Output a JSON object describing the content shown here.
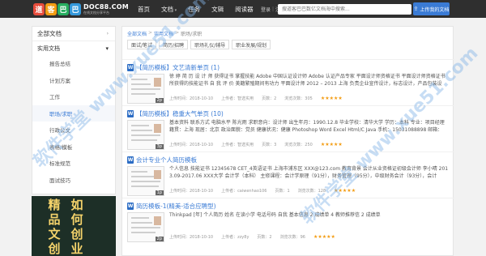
{
  "header": {
    "logo_chars": [
      "道",
      "客",
      "巴",
      "巴"
    ],
    "logo_title": "DOC88.COM",
    "logo_subtitle": "在线文档分享平台",
    "nav": [
      "首页",
      "文档",
      "任务",
      "文辑",
      "阅读器"
    ],
    "login": "登录",
    "register": "注册",
    "search_placeholder": "搜道客巴巴数亿文档海中搜索...",
    "upload_label": "上传我的文档"
  },
  "sidebar": {
    "title": "全部文档",
    "category": "实用文档",
    "items": [
      "报告总结",
      "计划方案",
      "工作",
      "职场/求职",
      "行政公文",
      "表格/模板",
      "标准规范",
      "面试技巧"
    ],
    "active_index": 3
  },
  "promo": {
    "text_col1": "精品文创",
    "text_col2": "如何创业"
  },
  "breadcrumb": [
    "全部文档",
    "实用文档",
    "职场/求职"
  ],
  "tabs": [
    "面试/笔试",
    "简历/招聘",
    "职场礼仪/辅导",
    "职业发展/规划"
  ],
  "documents": [
    {
      "title": "【简历模板】文艺清新单页 (1)",
      "excerpt": "徐 婷 简 历 设 计 师 获得证书 掌握技能 Adobe 中国认证设计师 Adobe 认证产品专家 平面设计师资格证书 平面设计师资格证书 所获得的技能证书 自 我 评 价 美籍繁殖期间有功力 平面设计师 2012 – 2013 上海 负责企业宣传设计，标志设计，产品包装设",
      "date": "上传时间：2018-10-10",
      "uploader": "上传者：智选实用",
      "pages": "页数：2",
      "views": "浏览次数：305",
      "rating": 5
    },
    {
      "title": "【简历模板】稳重大气单页 (10)",
      "excerpt": "基本资料 联系方式 电脑水平 陈光雨 求职意向：设计师 出生年月：1990.12.8 毕业学校：清华大学 学历：本科 专业：项目经理 籍贯：上海 现居：北京 政治面貌：党员 健康状况：健康 Photoshop Word Excel Html/C Java 手机：15031088898 邮箱：",
      "date": "上传时间：2018-10-10",
      "uploader": "上传者：智选实用",
      "pages": "页数：3",
      "views": "浏览次数：250",
      "rating": 5
    },
    {
      "title": "会计专业个人简历模板",
      "excerpt": "个人信息 技能证书 12345678 CET_4英语证书 上海市浦东区 XXX@123.com 教育背景 会计从业资格证初级会计师 李小晴 2013.09-2017.06 XXX大学 会计学（本科） 主修课程：会计学原理（91分），财务管理（95分），中级财务会计（93分），会计",
      "date": "上传时间：2018-10-10",
      "uploader": "上传者：caiwenhao106",
      "pages": "页数：1",
      "views": "浏览次数：128",
      "rating": 5
    },
    {
      "title": "简历模板-1(精美-适合应聘型)",
      "excerpt": "Thinkpad [年] 个人简历 姓名 在读小学 电话号码 自我 基本信息 2 成绩单 4 教师推荐信 2 成绩单",
      "date": "上传时间：2018-10-10",
      "uploader": "上传者：zzy8y",
      "pages": "页数：2",
      "views": "浏览次数：96",
      "rating": 5
    }
  ],
  "watermark_text": "软件学堂 www.xue51.com"
}
